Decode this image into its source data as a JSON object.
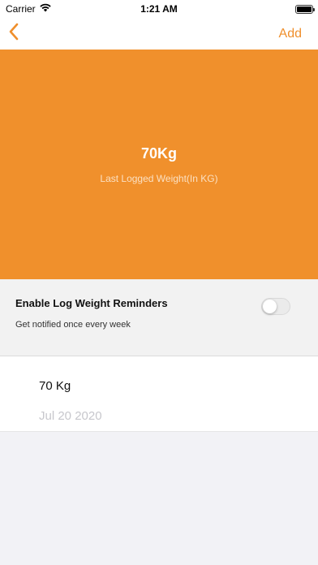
{
  "status": {
    "carrier": "Carrier",
    "time": "1:21 AM"
  },
  "nav": {
    "back_icon": "chevron-left-icon",
    "add_label": "Add",
    "accent_color": "#ef8f2c"
  },
  "hero": {
    "value": "70Kg",
    "subtitle": "Last Logged Weight(In KG)",
    "background_color": "#f0902c"
  },
  "reminder": {
    "title": "Enable Log Weight Reminders",
    "subtitle": "Get notified once every week",
    "enabled": false
  },
  "log": {
    "entries": [
      {
        "weight": "70 Kg",
        "date": "Jul 20 2020"
      }
    ]
  }
}
